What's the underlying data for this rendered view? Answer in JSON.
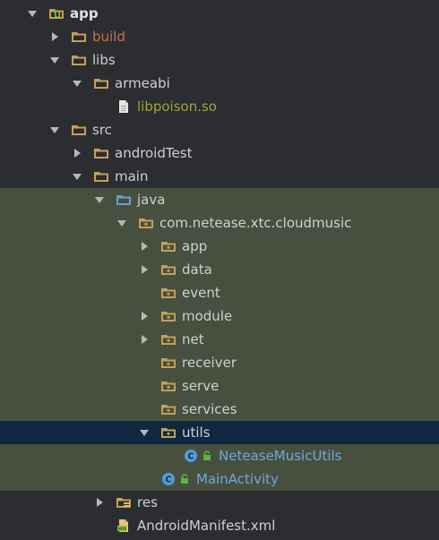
{
  "tree": {
    "app": "app",
    "build": "build",
    "libs": "libs",
    "armeabi": "armeabi",
    "libpoison": "libpoison.so",
    "src": "src",
    "androidTest": "androidTest",
    "main": "main",
    "java": "java",
    "package": "com.netease.xtc.cloudmusic",
    "pkg_app": "app",
    "pkg_data": "data",
    "pkg_event": "event",
    "pkg_module": "module",
    "pkg_net": "net",
    "pkg_receiver": "receiver",
    "pkg_serve": "serve",
    "pkg_services": "services",
    "pkg_utils": "utils",
    "netease_music_utils": "NeteaseMusicUtils",
    "main_activity": "MainActivity",
    "res": "res",
    "manifest": "AndroidManifest.xml"
  },
  "colors": {
    "background": "#2b2d30",
    "source_root_bg": "#47503f",
    "selection_bg": "#0f2740",
    "excluded_text": "#c9704a",
    "library_text": "#a6a23a",
    "class_text": "#6fa8dc",
    "folder": "#c6a05a"
  }
}
